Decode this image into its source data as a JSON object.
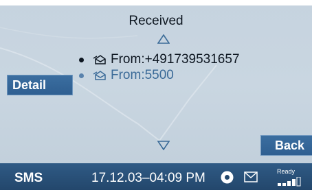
{
  "screen": {
    "title": "Received"
  },
  "messages": [
    {
      "label": "From:+491739531657",
      "selected": true
    },
    {
      "label": "From:5500",
      "selected": false
    }
  ],
  "softkeys": {
    "detail": "Detail",
    "back": "Back"
  },
  "statusbar": {
    "mode": "SMS",
    "datetime": "17.12.03–04:09 PM",
    "ready": "Ready",
    "icons": [
      "disc-icon",
      "envelope-icon",
      "signal-strength-icon"
    ]
  },
  "icons": {
    "scroll_up": "triangle-up-icon",
    "scroll_down": "triangle-down-icon",
    "message": "open-envelope-icon"
  },
  "colors": {
    "background": "#c6d3df",
    "softkey": "#3b6ea0",
    "statusbar": "#23476c",
    "text_primary": "#0d1620",
    "text_secondary": "#3b6b98"
  }
}
